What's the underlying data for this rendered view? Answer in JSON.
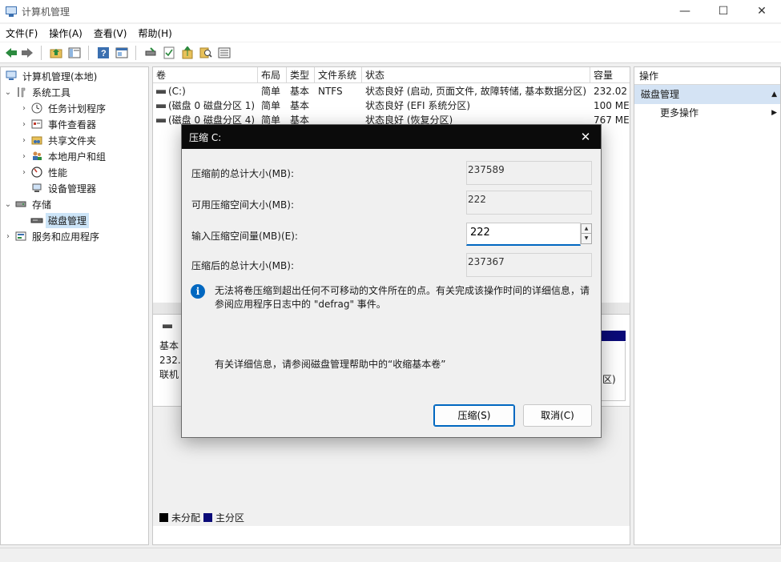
{
  "window": {
    "title": "计算机管理"
  },
  "menu": [
    "文件(F)",
    "操作(A)",
    "查看(V)",
    "帮助(H)"
  ],
  "tree": {
    "root": "计算机管理(本地)",
    "items": [
      {
        "label": "系统工具",
        "level": 1,
        "expand": "open",
        "icon": "tools-icon"
      },
      {
        "label": "任务计划程序",
        "level": 2,
        "expand": "closed",
        "icon": "clock-icon"
      },
      {
        "label": "事件查看器",
        "level": 2,
        "expand": "closed",
        "icon": "event-viewer-icon"
      },
      {
        "label": "共享文件夹",
        "level": 2,
        "expand": "closed",
        "icon": "shared-folder-icon"
      },
      {
        "label": "本地用户和组",
        "level": 2,
        "expand": "closed",
        "icon": "users-icon"
      },
      {
        "label": "性能",
        "level": 2,
        "expand": "closed",
        "icon": "performance-icon"
      },
      {
        "label": "设备管理器",
        "level": 2,
        "expand": "none",
        "icon": "device-manager-icon"
      },
      {
        "label": "存储",
        "level": 1,
        "expand": "open",
        "icon": "storage-icon"
      },
      {
        "label": "磁盘管理",
        "level": 2,
        "expand": "none",
        "icon": "disk-icon",
        "selected": true
      },
      {
        "label": "服务和应用程序",
        "level": 1,
        "expand": "closed",
        "icon": "services-icon"
      }
    ]
  },
  "volumes": {
    "headers": [
      "卷",
      "布局",
      "类型",
      "文件系统",
      "状态",
      "容量"
    ],
    "rows": [
      [
        "(C:)",
        "简单",
        "基本",
        "NTFS",
        "状态良好 (启动, 页面文件, 故障转储, 基本数据分区)",
        "232.02"
      ],
      [
        "(磁盘 0 磁盘分区 1)",
        "简单",
        "基本",
        "",
        "状态良好 (EFI 系统分区)",
        "100 ME"
      ],
      [
        "(磁盘 0 磁盘分区 4)",
        "简单",
        "基本",
        "",
        "状态良好 (恢复分区)",
        "767 ME"
      ]
    ]
  },
  "disk_view": {
    "info_lines": [
      "基本",
      "232.",
      "联机"
    ],
    "partition_fragment": "区)"
  },
  "legend": [
    {
      "label": "未分配",
      "color": "#000000"
    },
    {
      "label": "主分区",
      "color": "#0a0a78"
    }
  ],
  "actions": {
    "header": "操作",
    "section": "磁盘管理",
    "more": "更多操作"
  },
  "dialog": {
    "title": "压缩 C:",
    "total_before_label": "压缩前的总计大小(MB):",
    "total_before_value": "237589",
    "available_label": "可用压缩空间大小(MB):",
    "available_value": "222",
    "input_label": "输入压缩空间量(MB)(E):",
    "input_value": "222",
    "total_after_label": "压缩后的总计大小(MB):",
    "total_after_value": "237367",
    "info_text": "无法将卷压缩到超出任何不可移动的文件所在的点。有关完成该操作时间的详细信息，请参阅应用程序日志中的 \"defrag\" 事件。",
    "more_info": "有关详细信息，请参阅磁盘管理帮助中的“收缩基本卷”",
    "shrink_button": "压缩(S)",
    "cancel_button": "取消(C)"
  }
}
